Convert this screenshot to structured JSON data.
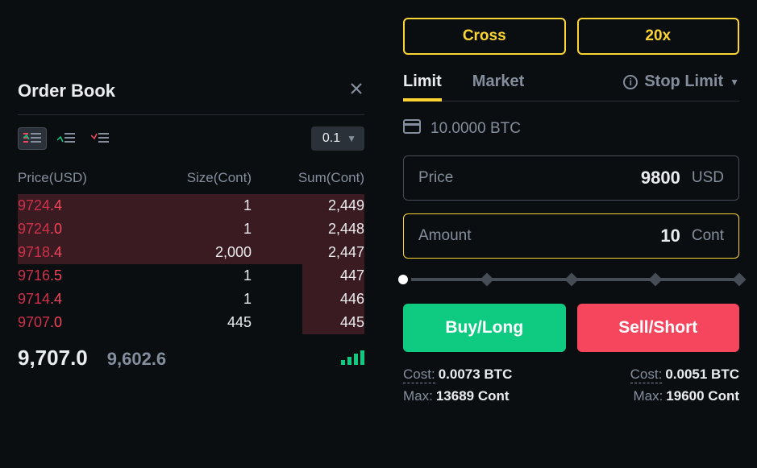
{
  "order_book": {
    "title": "Order Book",
    "tick_size": "0.1",
    "headers": {
      "price": "Price(USD)",
      "size": "Size(Cont)",
      "sum": "Sum(Cont)"
    },
    "asks": [
      {
        "price_int": "9724",
        "price_dec": ".4",
        "size": "1",
        "sum": "2,449",
        "fill_pct": 100
      },
      {
        "price_int": "9724",
        "price_dec": ".0",
        "size": "1",
        "sum": "2,448",
        "fill_pct": 100
      },
      {
        "price_int": "9718",
        "price_dec": ".4",
        "size": "2,000",
        "sum": "2,447",
        "fill_pct": 100
      },
      {
        "price_int": "9716",
        "price_dec": ".5",
        "size": "1",
        "sum": "447",
        "fill_pct": 18
      },
      {
        "price_int": "9714",
        "price_dec": ".4",
        "size": "1",
        "sum": "446",
        "fill_pct": 18
      },
      {
        "price_int": "9707",
        "price_dec": ".0",
        "size": "445",
        "sum": "445",
        "fill_pct": 18
      }
    ],
    "mid": {
      "last": "9,707.0",
      "mark": "9,602.6"
    }
  },
  "trade": {
    "margin_mode": "Cross",
    "leverage": "20x",
    "tabs": {
      "limit": "Limit",
      "market": "Market",
      "stop": "Stop Limit"
    },
    "balance": "10.0000 BTC",
    "price": {
      "label": "Price",
      "value": "9800",
      "unit": "USD"
    },
    "amount": {
      "label": "Amount",
      "value": "10",
      "unit": "Cont"
    },
    "buy_label": "Buy/Long",
    "sell_label": "Sell/Short",
    "buy_stats": {
      "cost_k": "Cost:",
      "cost_v": "0.0073 BTC",
      "max_k": "Max:",
      "max_v": "13689 Cont"
    },
    "sell_stats": {
      "cost_k": "Cost:",
      "cost_v": "0.0051 BTC",
      "max_k": "Max:",
      "max_v": "19600 Cont"
    }
  }
}
